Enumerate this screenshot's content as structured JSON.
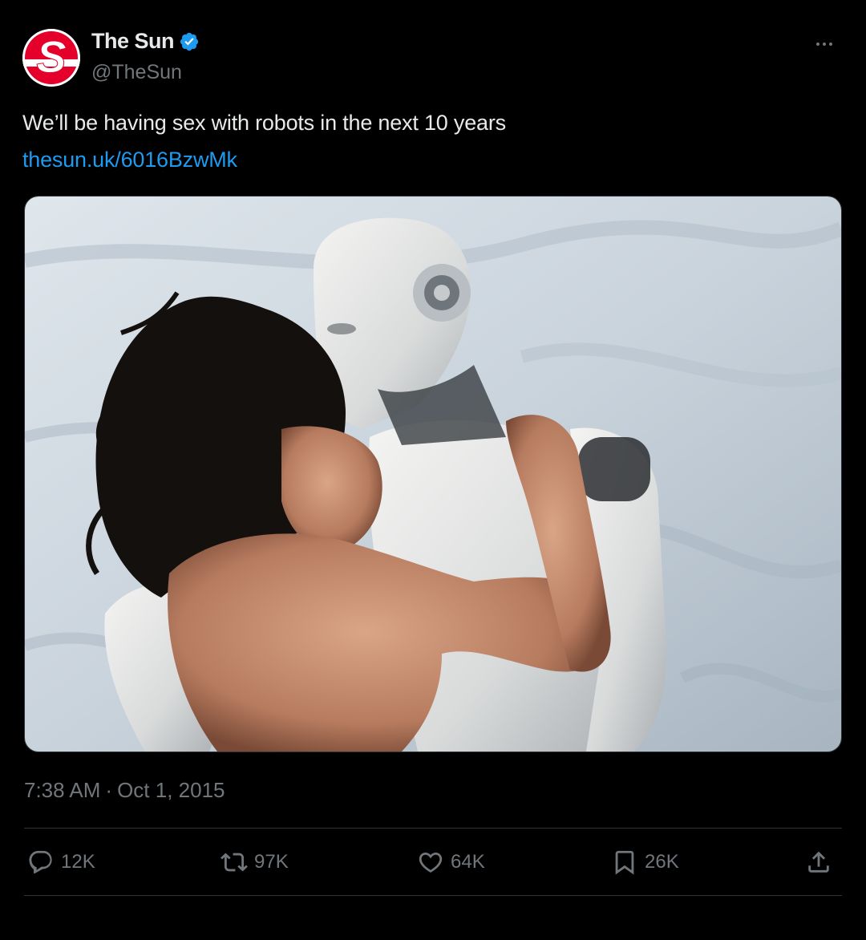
{
  "author": {
    "display_name": "The Sun",
    "handle": "@TheSun",
    "avatar_letter": "S",
    "avatar_color": "#e4002b",
    "verified_color": "#1d9bf0"
  },
  "tweet": {
    "text": "We’ll be having sex with robots in the next 10 years",
    "link": "thesun.uk/6016BzwMk",
    "time": "7:38 AM",
    "separator": "·",
    "date": "Oct 1, 2015"
  },
  "actions": {
    "replies": {
      "icon": "reply-icon",
      "count": "12K"
    },
    "reposts": {
      "icon": "repost-icon",
      "count": "97K"
    },
    "likes": {
      "icon": "heart-icon",
      "count": "64K"
    },
    "bookmarks": {
      "icon": "bookmark-icon",
      "count": "26K"
    },
    "share": {
      "icon": "share-icon"
    }
  },
  "colors": {
    "background": "#000000",
    "text": "#e7e9ea",
    "muted": "#71767b",
    "link": "#1d9bf0",
    "divider": "#2f3336"
  }
}
